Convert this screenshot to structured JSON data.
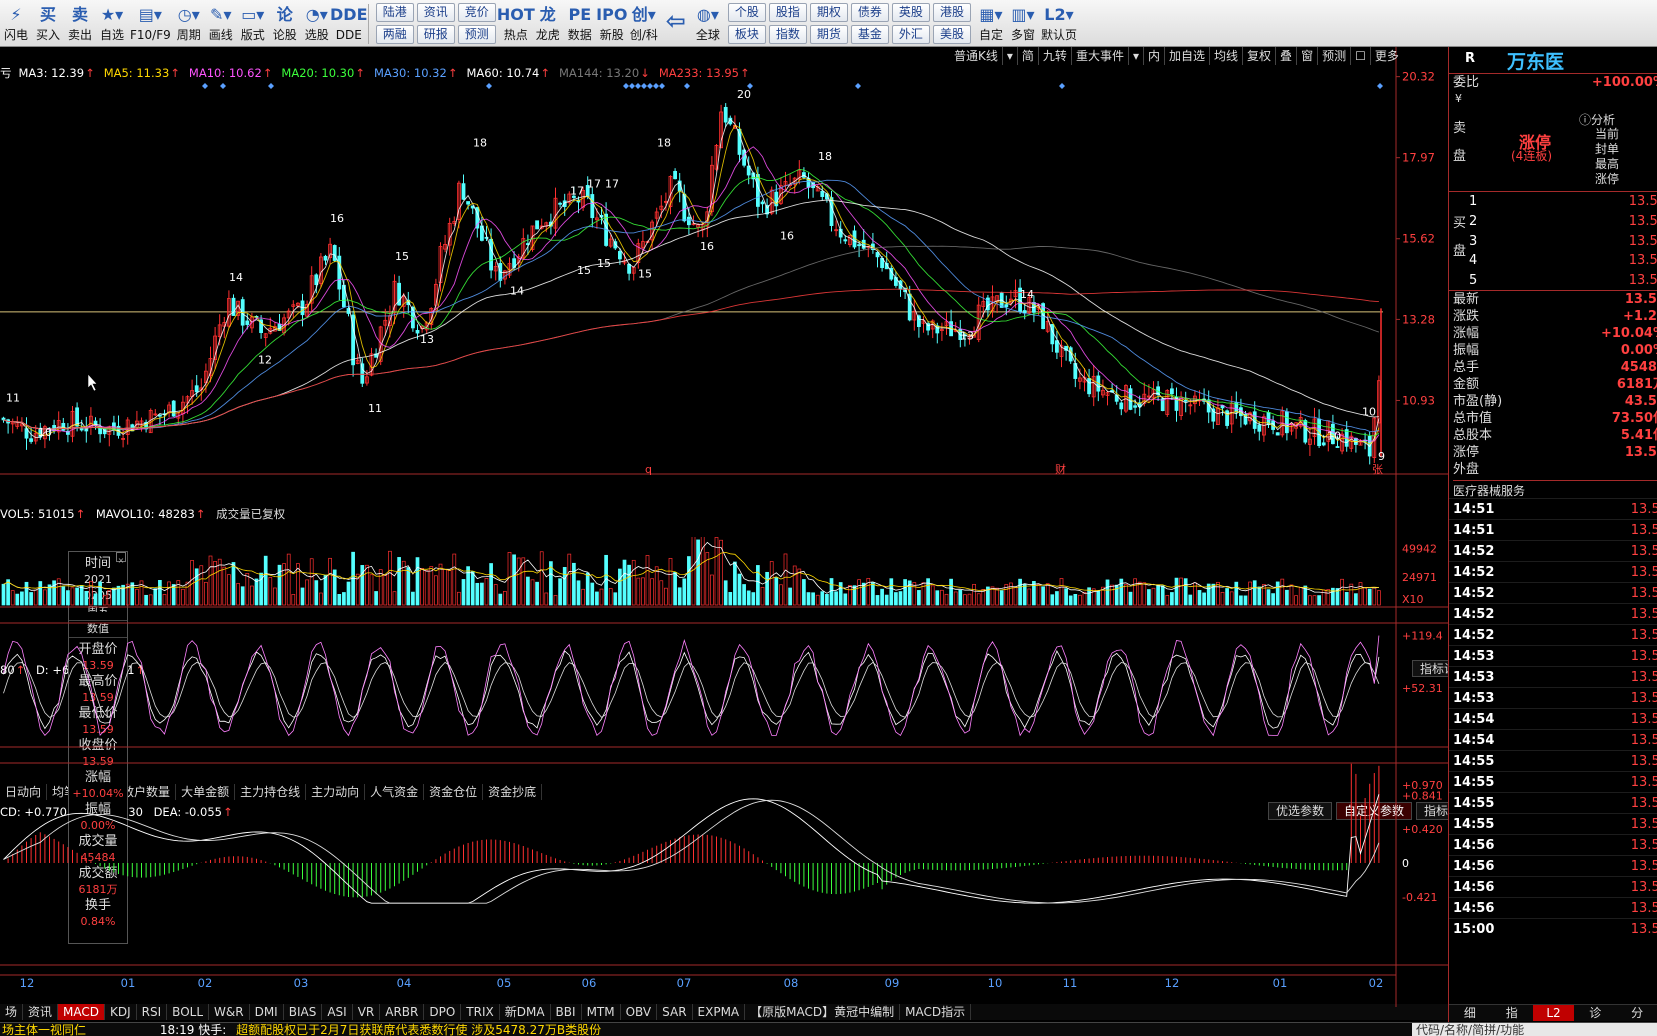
{
  "toolbar": {
    "buttons": [
      {
        "id": "flash",
        "label": "闪电",
        "icon": "flash-icon",
        "glyph": "⚡"
      },
      {
        "id": "buy",
        "label": "买入",
        "icon": "buy-icon",
        "glyph": "买"
      },
      {
        "id": "sell",
        "label": "卖出",
        "icon": "sell-icon",
        "glyph": "卖"
      },
      {
        "id": "watchlist",
        "label": "自选",
        "icon": "star-icon",
        "glyph": "★▾"
      },
      {
        "id": "f10",
        "label": "F10/F9",
        "icon": "document-icon",
        "glyph": "▤▾"
      },
      {
        "id": "period",
        "label": "周期",
        "icon": "clock-icon",
        "glyph": "◷▾"
      },
      {
        "id": "draw",
        "label": "画线",
        "icon": "pen-icon",
        "glyph": "✎▾"
      },
      {
        "id": "layout",
        "label": "版式",
        "icon": "monitor-icon",
        "glyph": "▭▾"
      },
      {
        "id": "forum",
        "label": "论股",
        "icon": "chat-icon",
        "glyph": "论"
      },
      {
        "id": "picker",
        "label": "选股",
        "icon": "pick-icon",
        "glyph": "◔▾"
      },
      {
        "id": "dde",
        "label": "DDE",
        "icon": "dde-icon",
        "glyph": "DDE"
      }
    ],
    "grid1": [
      "陆港",
      "资讯",
      "竞价",
      "两融",
      "研报",
      "预测"
    ],
    "buttons2": [
      {
        "id": "hot",
        "label": "热点",
        "icon": "hot-icon",
        "glyph": "HOT"
      },
      {
        "id": "dragon",
        "label": "龙虎",
        "icon": "dragon-icon",
        "glyph": "龙"
      },
      {
        "id": "data",
        "label": "数据",
        "icon": "pe-icon",
        "glyph": "PE"
      },
      {
        "id": "ipo",
        "label": "新股",
        "icon": "newstock-icon",
        "glyph": "IPO"
      },
      {
        "id": "chuang",
        "label": "创/科",
        "icon": "chuang-icon",
        "glyph": "创▾"
      }
    ],
    "back_icon": "back-arrow-icon",
    "global": {
      "label": "全球",
      "icon": "globe-icon",
      "glyph": "◍▾"
    },
    "grid2": [
      "个股",
      "股指",
      "期权",
      "债券",
      "英股",
      "港股",
      "板块",
      "指数",
      "期货",
      "基金",
      "外汇",
      "美股"
    ],
    "buttons3": [
      {
        "id": "custom",
        "label": "自定",
        "icon": "custom-icon",
        "glyph": "▦▾"
      },
      {
        "id": "multi",
        "label": "多窗",
        "icon": "multiwindow-icon",
        "glyph": "▥▾"
      },
      {
        "id": "default",
        "label": "默认页",
        "icon": "l2-icon",
        "glyph": "L2▾"
      }
    ]
  },
  "chart_toolbar": [
    "普通K线",
    "▾",
    "简",
    "九转",
    "重大事件",
    "▾",
    "内",
    "加自选",
    "均线",
    "复权",
    "叠",
    "窗",
    "预测",
    "☐",
    "更多",
    "▶|",
    "▾"
  ],
  "ma_legend": {
    "prefix": "亏",
    "items": [
      {
        "t": "MA3: 12.39",
        "c": "#ffffff"
      },
      {
        "t": "MA5: 11.33",
        "c": "#ffd800"
      },
      {
        "t": "MA10: 10.62",
        "c": "#ff55ff"
      },
      {
        "t": "MA20: 10.30",
        "c": "#3cff3c"
      },
      {
        "t": "MA30: 10.32",
        "c": "#5aa0ff"
      },
      {
        "t": "MA60: 10.74",
        "c": "#ffffff"
      },
      {
        "t": "MA144: 13.20",
        "c": "#777777"
      },
      {
        "t": "MA233: 13.95",
        "c": "#ff4040"
      }
    ]
  },
  "price_axis": [
    "20.32",
    "17.97",
    "15.62",
    "13.28",
    "10.93"
  ],
  "price_range": [
    9.0,
    20.6
  ],
  "vol_legend": {
    "a": "VOL5: 51015",
    "b": "MAVOL10: 48283",
    "c": "成交量已复权"
  },
  "vol_axis": [
    "49942",
    "24971",
    "X10"
  ],
  "vol_range": [
    0,
    55000
  ],
  "kdj_legend": {
    "a": "80",
    "b": "D: +63.9",
    "c": "9.1"
  },
  "kdj_axis": [
    "+119.4",
    "+52.31"
  ],
  "kdj_button": "指标说明",
  "mid_tabs": [
    "日动向",
    "均笔",
    "净量",
    "散户数量",
    "大单金额",
    "主力持仓线",
    "主力动向",
    "人气资金",
    "资金仓位",
    "资金抄底"
  ],
  "macd_legend": {
    "a": "CD: +0.770",
    "b": "30",
    "c": "DEA: -0.055"
  },
  "macd_axis": [
    "+0.970",
    "+0.841",
    "+0.420",
    "0",
    "-0.421"
  ],
  "macd_buttons": [
    "优选参数",
    "自定义参数",
    "指标说明"
  ],
  "x_axis": [
    "12",
    "01",
    "02",
    "03",
    "04",
    "05",
    "06",
    "07",
    "08",
    "09",
    "10",
    "11",
    "12",
    "01",
    "02"
  ],
  "bottom_tabs": [
    "场",
    "资讯",
    "MACD",
    "KDJ",
    "RSI",
    "BOLL",
    "W&R",
    "DMI",
    "BIAS",
    "ASI",
    "VR",
    "ARBR",
    "DPO",
    "TRIX",
    "新DMA",
    "BBI",
    "MTM",
    "OBV",
    "SAR",
    "EXPMA",
    "【原版MACD】黄冠中编制",
    "MACD指示"
  ],
  "bottom_tab_selected": "MACD",
  "markers": {
    "q": "q",
    "cai": "财",
    "zhang": "张"
  },
  "chart_data": {
    "type": "candlestick",
    "title": "",
    "xlabel": "",
    "ylabel": "",
    "ylim": [
      9.0,
      20.6
    ],
    "labels": [
      {
        "t": "11",
        "x": 6,
        "y": 10.9
      },
      {
        "t": "10",
        "x": 38,
        "y": 9.9
      },
      {
        "t": "14",
        "x": 229,
        "y": 14.4
      },
      {
        "t": "12",
        "x": 258,
        "y": 12.0
      },
      {
        "t": "16",
        "x": 330,
        "y": 16.1
      },
      {
        "t": "11",
        "x": 368,
        "y": 10.6
      },
      {
        "t": "15",
        "x": 395,
        "y": 15.0
      },
      {
        "t": "13",
        "x": 420,
        "y": 12.6
      },
      {
        "t": "18",
        "x": 473,
        "y": 18.3
      },
      {
        "t": "14",
        "x": 510,
        "y": 14.0
      },
      {
        "t": "17",
        "x": 570,
        "y": 16.9
      },
      {
        "t": "17",
        "x": 587,
        "y": 17.1
      },
      {
        "t": "17",
        "x": 605,
        "y": 17.1
      },
      {
        "t": "15",
        "x": 577,
        "y": 14.6
      },
      {
        "t": "15",
        "x": 597,
        "y": 14.8
      },
      {
        "t": "18",
        "x": 657,
        "y": 18.3
      },
      {
        "t": "15",
        "x": 638,
        "y": 14.5
      },
      {
        "t": "16",
        "x": 700,
        "y": 15.3
      },
      {
        "t": "20",
        "x": 737,
        "y": 19.7
      },
      {
        "t": "18",
        "x": 818,
        "y": 17.9
      },
      {
        "t": "16",
        "x": 780,
        "y": 15.6
      },
      {
        "t": "14",
        "x": 1020,
        "y": 13.9
      },
      {
        "t": "13",
        "x": 960,
        "y": 12.7
      },
      {
        "t": "10",
        "x": 1327,
        "y": 9.8
      },
      {
        "t": "10",
        "x": 1362,
        "y": 10.5
      },
      {
        "t": "9",
        "x": 1378,
        "y": 9.2
      }
    ],
    "series": [
      {
        "name": "MA3",
        "color": "#ffffff",
        "values": [
          12.39
        ]
      },
      {
        "name": "MA5",
        "color": "#ffd800",
        "values": [
          11.33
        ]
      },
      {
        "name": "MA10",
        "color": "#ff55ff",
        "values": [
          10.62
        ]
      },
      {
        "name": "MA20",
        "color": "#3cff3c",
        "values": [
          10.3
        ]
      },
      {
        "name": "MA30",
        "color": "#5aa0ff",
        "values": [
          10.32
        ]
      },
      {
        "name": "MA60",
        "color": "#ffffff",
        "values": [
          10.74
        ]
      },
      {
        "name": "MA144",
        "color": "#777777",
        "values": [
          13.2
        ]
      },
      {
        "name": "MA233",
        "color": "#ff4040",
        "values": [
          13.95
        ]
      }
    ],
    "trend_knots": [
      [
        0,
        10.4
      ],
      [
        30,
        10.0
      ],
      [
        60,
        10.3
      ],
      [
        110,
        10.1
      ],
      [
        160,
        10.5
      ],
      [
        200,
        11.3
      ],
      [
        225,
        13.8
      ],
      [
        260,
        12.9
      ],
      [
        300,
        13.6
      ],
      [
        330,
        15.3
      ],
      [
        360,
        11.4
      ],
      [
        395,
        14.2
      ],
      [
        420,
        13.0
      ],
      [
        460,
        17.2
      ],
      [
        495,
        14.5
      ],
      [
        540,
        16.2
      ],
      [
        580,
        16.8
      ],
      [
        630,
        14.8
      ],
      [
        670,
        17.1
      ],
      [
        700,
        15.7
      ],
      [
        720,
        19.5
      ],
      [
        760,
        16.5
      ],
      [
        800,
        17.4
      ],
      [
        840,
        15.8
      ],
      [
        880,
        15.0
      ],
      [
        920,
        13.0
      ],
      [
        960,
        13.0
      ],
      [
        1010,
        14.0
      ],
      [
        1040,
        13.4
      ],
      [
        1070,
        11.6
      ],
      [
        1120,
        11.0
      ],
      [
        1180,
        10.9
      ],
      [
        1220,
        10.5
      ],
      [
        1260,
        10.4
      ],
      [
        1300,
        10.1
      ],
      [
        1340,
        9.9
      ],
      [
        1370,
        9.4
      ],
      [
        1380,
        13.4
      ]
    ]
  },
  "right_panel": {
    "code": "R",
    "name": "万东医",
    "weibi_label": "委比",
    "weibi_value": "+100.00%",
    "yen": "¥",
    "sell_label": [
      "卖",
      "盘"
    ],
    "buy_label": [
      "买",
      "盘"
    ],
    "limit_up": "涨停",
    "limit_up_sub": "(4连板)",
    "analysis": "ⓘ分析",
    "side_notes": [
      "当前",
      "封单",
      "最高",
      "涨停"
    ],
    "buy_levels": [
      {
        "n": "1",
        "p": "13.59"
      },
      {
        "n": "2",
        "p": "13.58"
      },
      {
        "n": "3",
        "p": "13.57"
      },
      {
        "n": "4",
        "p": "13.56"
      },
      {
        "n": "5",
        "p": "13.55"
      }
    ],
    "stats": [
      {
        "k": "最新",
        "v": "13.59"
      },
      {
        "k": "涨跌",
        "v": "+1.24"
      },
      {
        "k": "涨幅",
        "v": "+10.04%"
      },
      {
        "k": "振幅",
        "v": "0.00%"
      },
      {
        "k": "总手",
        "v": "45484"
      },
      {
        "k": "金额",
        "v": "6181万"
      },
      {
        "k": "市盈(静)",
        "v": "43.52"
      },
      {
        "k": "总市值",
        "v": "73.50亿"
      },
      {
        "k": "总股本",
        "v": "5.41亿"
      },
      {
        "k": "涨停",
        "v": "13.59"
      },
      {
        "k": "外盘",
        "v": "0"
      }
    ],
    "sector": "医疗器械服务",
    "ticks": [
      {
        "t": "14:51",
        "p": "13.59"
      },
      {
        "t": "14:51",
        "p": "13.59"
      },
      {
        "t": "14:52",
        "p": "13.59"
      },
      {
        "t": "14:52",
        "p": "13.59"
      },
      {
        "t": "14:52",
        "p": "13.59"
      },
      {
        "t": "14:52",
        "p": "13.59"
      },
      {
        "t": "14:52",
        "p": "13.59"
      },
      {
        "t": "14:53",
        "p": "13.59"
      },
      {
        "t": "14:53",
        "p": "13.59"
      },
      {
        "t": "14:53",
        "p": "13.59"
      },
      {
        "t": "14:54",
        "p": "13.59"
      },
      {
        "t": "14:54",
        "p": "13.59"
      },
      {
        "t": "14:55",
        "p": "13.59"
      },
      {
        "t": "14:55",
        "p": "13.59"
      },
      {
        "t": "14:55",
        "p": "13.59"
      },
      {
        "t": "14:55",
        "p": "13.59"
      },
      {
        "t": "14:56",
        "p": "13.59"
      },
      {
        "t": "14:56",
        "p": "13.59"
      },
      {
        "t": "14:56",
        "p": "13.59"
      },
      {
        "t": "14:56",
        "p": "13.59"
      },
      {
        "t": "15:00",
        "p": "13.59"
      }
    ],
    "bottom_tabs": [
      "细",
      "指",
      "L2",
      "诊",
      "分"
    ]
  },
  "infobox": {
    "title": "时间",
    "date1": "2021",
    "date2": "0205",
    "date3": "周五",
    "tag": "数值",
    "rows": [
      {
        "k": "开盘价",
        "v": "13.59"
      },
      {
        "k": "最高价",
        "v": "13.59"
      },
      {
        "k": "最低价",
        "v": "13.59"
      },
      {
        "k": "收盘价",
        "v": "13.59"
      },
      {
        "k": "涨幅",
        "v": "+10.04%"
      },
      {
        "k": "振幅",
        "v": "0.00%"
      },
      {
        "k": "成交量",
        "v": "45484"
      },
      {
        "k": "成交额",
        "v": "6181万"
      },
      {
        "k": "换手",
        "v": "0.84%"
      }
    ]
  },
  "news": {
    "left": "场主体一视同仁",
    "time": "18:19 快手:",
    "text": "超额配股权已于2月7日获联席代表悉数行使 涉及5478.27万B类股份",
    "right": "代码/名称/简拼/功能"
  }
}
